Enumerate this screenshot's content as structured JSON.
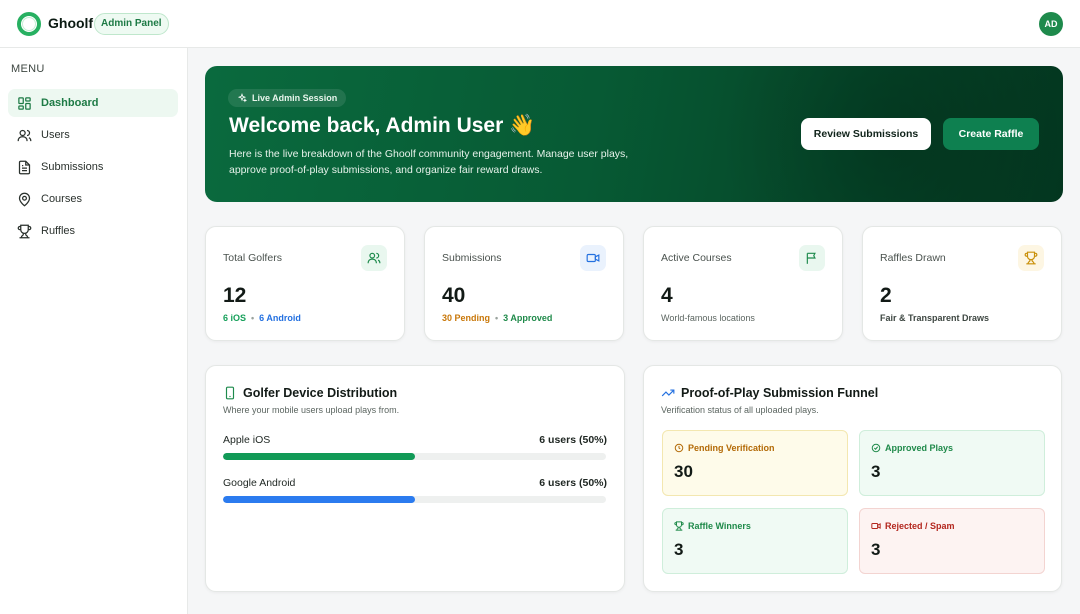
{
  "app": {
    "brand": "Ghoolf",
    "badge": "Admin Panel",
    "avatar_initials": "AD"
  },
  "sidebar": {
    "menu_label": "MENU",
    "items": [
      {
        "label": "Dashboard",
        "icon": "grid-icon",
        "active": true
      },
      {
        "label": "Users",
        "icon": "users-icon",
        "active": false
      },
      {
        "label": "Submissions",
        "icon": "document-icon",
        "active": false
      },
      {
        "label": "Courses",
        "icon": "map-pin-icon",
        "active": false
      },
      {
        "label": "Ruffles",
        "icon": "trophy-icon",
        "active": false
      }
    ]
  },
  "hero": {
    "session_label": "Live Admin Session",
    "title": "Welcome back, Admin User 👋",
    "description": "Here is the live breakdown of the Ghoolf community engagement. Manage user plays, approve proof-of-play submissions, and organize fair reward draws.",
    "review_button": "Review Submissions",
    "create_button": "Create Raffle"
  },
  "stats": {
    "golfers": {
      "label": "Total Golfers",
      "value": "12",
      "sub_a": "6 iOS",
      "sub_b": "6 Android"
    },
    "submissions": {
      "label": "Submissions",
      "value": "40",
      "sub_a": "30 Pending",
      "sub_b": "3 Approved"
    },
    "courses": {
      "label": "Active Courses",
      "value": "4",
      "sub": "World-famous locations"
    },
    "raffles": {
      "label": "Raffles Drawn",
      "value": "2",
      "sub": "Fair & Transparent Draws"
    }
  },
  "devices": {
    "title": "Golfer Device Distribution",
    "subtitle": "Where your mobile users upload plays from.",
    "rows": [
      {
        "label": "Apple iOS",
        "value": "6 users (50%)",
        "fraction": 0.5,
        "color": "#119a57"
      },
      {
        "label": "Google Android",
        "value": "6 users (50%)",
        "fraction": 0.5,
        "color": "#2b7bef"
      }
    ]
  },
  "funnel": {
    "title": "Proof-of-Play Submission Funnel",
    "subtitle": "Verification status of all uploaded plays.",
    "boxes": [
      {
        "label": "Pending Verification",
        "value": "30"
      },
      {
        "label": "Approved Plays",
        "value": "3"
      },
      {
        "label": "Raffle Winners",
        "value": "3"
      },
      {
        "label": "Rejected / Spam",
        "value": "3"
      }
    ]
  },
  "colors": {
    "accent": "#1d7a45",
    "ios_text": "#16a05a",
    "android_text": "#2370e0",
    "pending": "#c9780a",
    "approved": "#1f8a4a",
    "rejected": "#b3261e"
  }
}
